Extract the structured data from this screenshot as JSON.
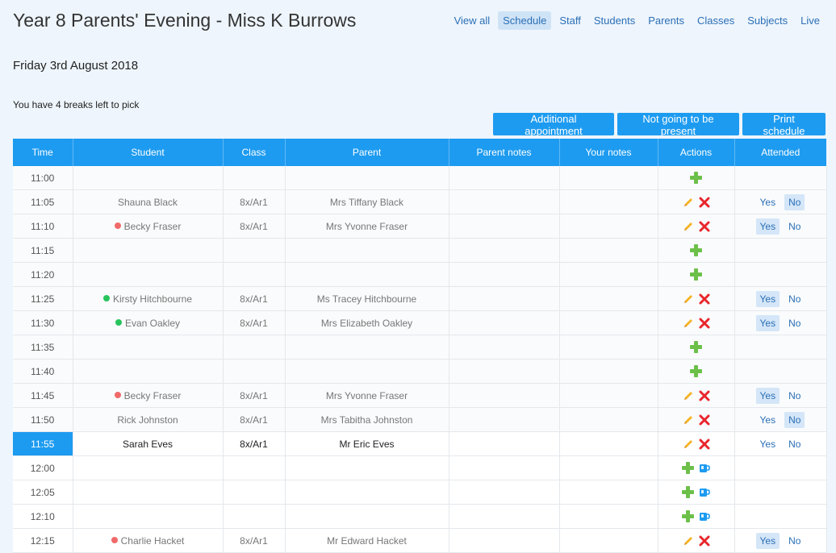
{
  "page": {
    "title": "Year 8 Parents' Evening - Miss K Burrows",
    "date": "Friday 3rd August 2018",
    "breaks_text": "You have 4 breaks left to pick"
  },
  "nav": [
    {
      "label": "View all",
      "active": false
    },
    {
      "label": "Schedule",
      "active": true
    },
    {
      "label": "Staff",
      "active": false
    },
    {
      "label": "Students",
      "active": false
    },
    {
      "label": "Parents",
      "active": false
    },
    {
      "label": "Classes",
      "active": false
    },
    {
      "label": "Subjects",
      "active": false
    },
    {
      "label": "Live",
      "active": false
    }
  ],
  "buttons": {
    "additional": "Additional appointment",
    "not_present": "Not going to be present",
    "print": "Print schedule"
  },
  "columns": [
    "Time",
    "Student",
    "Class",
    "Parent",
    "Parent notes",
    "Your notes",
    "Actions",
    "Attended"
  ],
  "attended_labels": {
    "yes": "Yes",
    "no": "No"
  },
  "colors": {
    "accent": "#1d9bf0",
    "status_red": "#f06a6a",
    "status_green": "#27c45c",
    "add_green": "#6cc04a",
    "delete_red": "#e8262c",
    "edit_yellow": "#f5b324"
  },
  "rows": [
    {
      "time": "11:00",
      "empty": true,
      "white": false
    },
    {
      "time": "11:05",
      "student": "Shauna Black",
      "dot": "",
      "class": "8x/Ar1",
      "parent": "Mrs Tiffany Black",
      "attended": "no",
      "white": false
    },
    {
      "time": "11:10",
      "student": "Becky Fraser",
      "dot": "red",
      "class": "8x/Ar1",
      "parent": "Mrs Yvonne Fraser",
      "attended": "yes",
      "white": false
    },
    {
      "time": "11:15",
      "empty": true,
      "white": false
    },
    {
      "time": "11:20",
      "empty": true,
      "white": false
    },
    {
      "time": "11:25",
      "student": "Kirsty Hitchbourne",
      "dot": "green",
      "class": "8x/Ar1",
      "parent": "Ms Tracey Hitchbourne",
      "attended": "yes",
      "white": false
    },
    {
      "time": "11:30",
      "student": "Evan Oakley",
      "dot": "green",
      "class": "8x/Ar1",
      "parent": "Mrs Elizabeth Oakley",
      "attended": "yes",
      "white": false
    },
    {
      "time": "11:35",
      "empty": true,
      "white": false
    },
    {
      "time": "11:40",
      "empty": true,
      "white": false
    },
    {
      "time": "11:45",
      "student": "Becky Fraser",
      "dot": "red",
      "class": "8x/Ar1",
      "parent": "Mrs Yvonne Fraser",
      "attended": "yes",
      "white": false
    },
    {
      "time": "11:50",
      "student": "Rick Johnston",
      "dot": "",
      "class": "8x/Ar1",
      "parent": "Mrs Tabitha Johnston",
      "attended": "no",
      "white": false
    },
    {
      "time": "11:55",
      "student": "Sarah Eves",
      "dot": "",
      "class": "8x/Ar1",
      "parent": "Mr Eric Eves",
      "attended": "none",
      "current": true
    },
    {
      "time": "12:00",
      "empty": true,
      "breakable": true,
      "white": true
    },
    {
      "time": "12:05",
      "empty": true,
      "breakable": true,
      "white": true
    },
    {
      "time": "12:10",
      "empty": true,
      "breakable": true,
      "white": true
    },
    {
      "time": "12:15",
      "student": "Charlie Hacket",
      "dot": "red",
      "class": "8x/Ar1",
      "parent": "Mr Edward Hacket",
      "attended": "yes",
      "white": true
    }
  ]
}
